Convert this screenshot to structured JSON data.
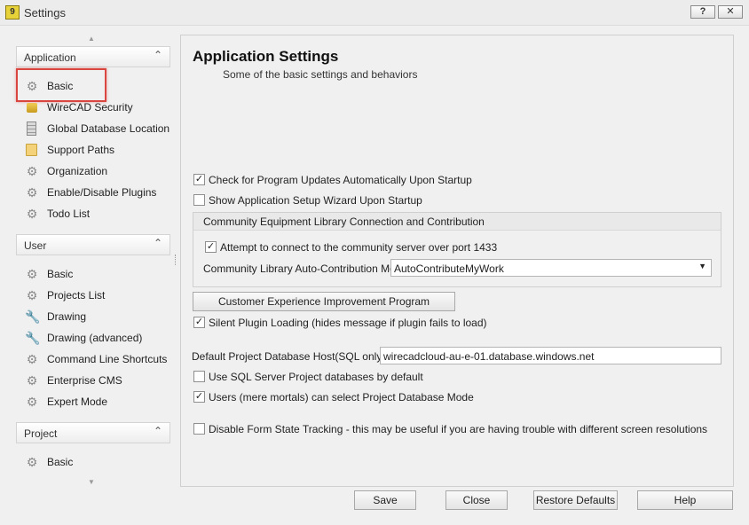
{
  "window": {
    "title": "Settings",
    "app_icon_glyph": "9",
    "help_glyph": "?",
    "close_glyph": "✕"
  },
  "sidebar": {
    "groups": [
      {
        "label": "Application",
        "items": [
          {
            "label": "Basic",
            "icon": "gear-icon",
            "selected": true
          },
          {
            "label": "WireCAD Security",
            "icon": "lock-icon"
          },
          {
            "label": "Global Database Location",
            "icon": "database-icon"
          },
          {
            "label": "Support Paths",
            "icon": "folder-icon"
          },
          {
            "label": "Organization",
            "icon": "gear-icon"
          },
          {
            "label": "Enable/Disable Plugins",
            "icon": "gear-icon"
          },
          {
            "label": "Todo List",
            "icon": "gear-icon"
          }
        ]
      },
      {
        "label": "User",
        "items": [
          {
            "label": "Basic",
            "icon": "gear-icon"
          },
          {
            "label": "Projects List",
            "icon": "gear-icon"
          },
          {
            "label": "Drawing",
            "icon": "wrench-icon"
          },
          {
            "label": "Drawing (advanced)",
            "icon": "wrench-icon"
          },
          {
            "label": "Command Line Shortcuts",
            "icon": "gear-icon"
          },
          {
            "label": "Enterprise CMS",
            "icon": "gear-icon"
          },
          {
            "label": "Expert Mode",
            "icon": "gear-icon"
          }
        ]
      },
      {
        "label": "Project",
        "items": [
          {
            "label": "Basic",
            "icon": "gear-icon"
          }
        ]
      }
    ]
  },
  "content": {
    "title": "Application Settings",
    "subtitle": "Some of the basic settings and behaviors",
    "check_updates": {
      "label": "Check for Program Updates Automatically Upon Startup",
      "checked": true
    },
    "show_wizard": {
      "label": "Show Application Setup Wizard Upon Startup",
      "checked": false
    },
    "community_group": {
      "title": "Community Equipment Library Connection and Contribution",
      "connect": {
        "label": "Attempt to connect to the community server over port 1433",
        "checked": true
      },
      "mode_label": "Community Library Auto-Contribution Mode",
      "mode_value": "AutoContributeMyWork"
    },
    "ceip_button": "Customer Experience Improvement Program",
    "silent_plugin": {
      "label": "Silent Plugin Loading (hides message if plugin fails to load)",
      "checked": true
    },
    "db_host_label": "Default Project Database Host(SQL only)",
    "db_host_value": "wirecadcloud-au-e-01.database.windows.net",
    "use_sql": {
      "label": "Use SQL Server Project databases by default",
      "checked": false
    },
    "users_select": {
      "label": "Users (mere mortals) can select Project Database Mode",
      "checked": true
    },
    "disable_form": {
      "label": "Disable Form State Tracking - this may be useful if you are having trouble with different screen resolutions",
      "checked": false
    }
  },
  "footer": {
    "save": "Save",
    "close": "Close",
    "restore": "Restore Defaults",
    "help": "Help"
  },
  "colors": {
    "selection_outline": "#d9463f"
  }
}
